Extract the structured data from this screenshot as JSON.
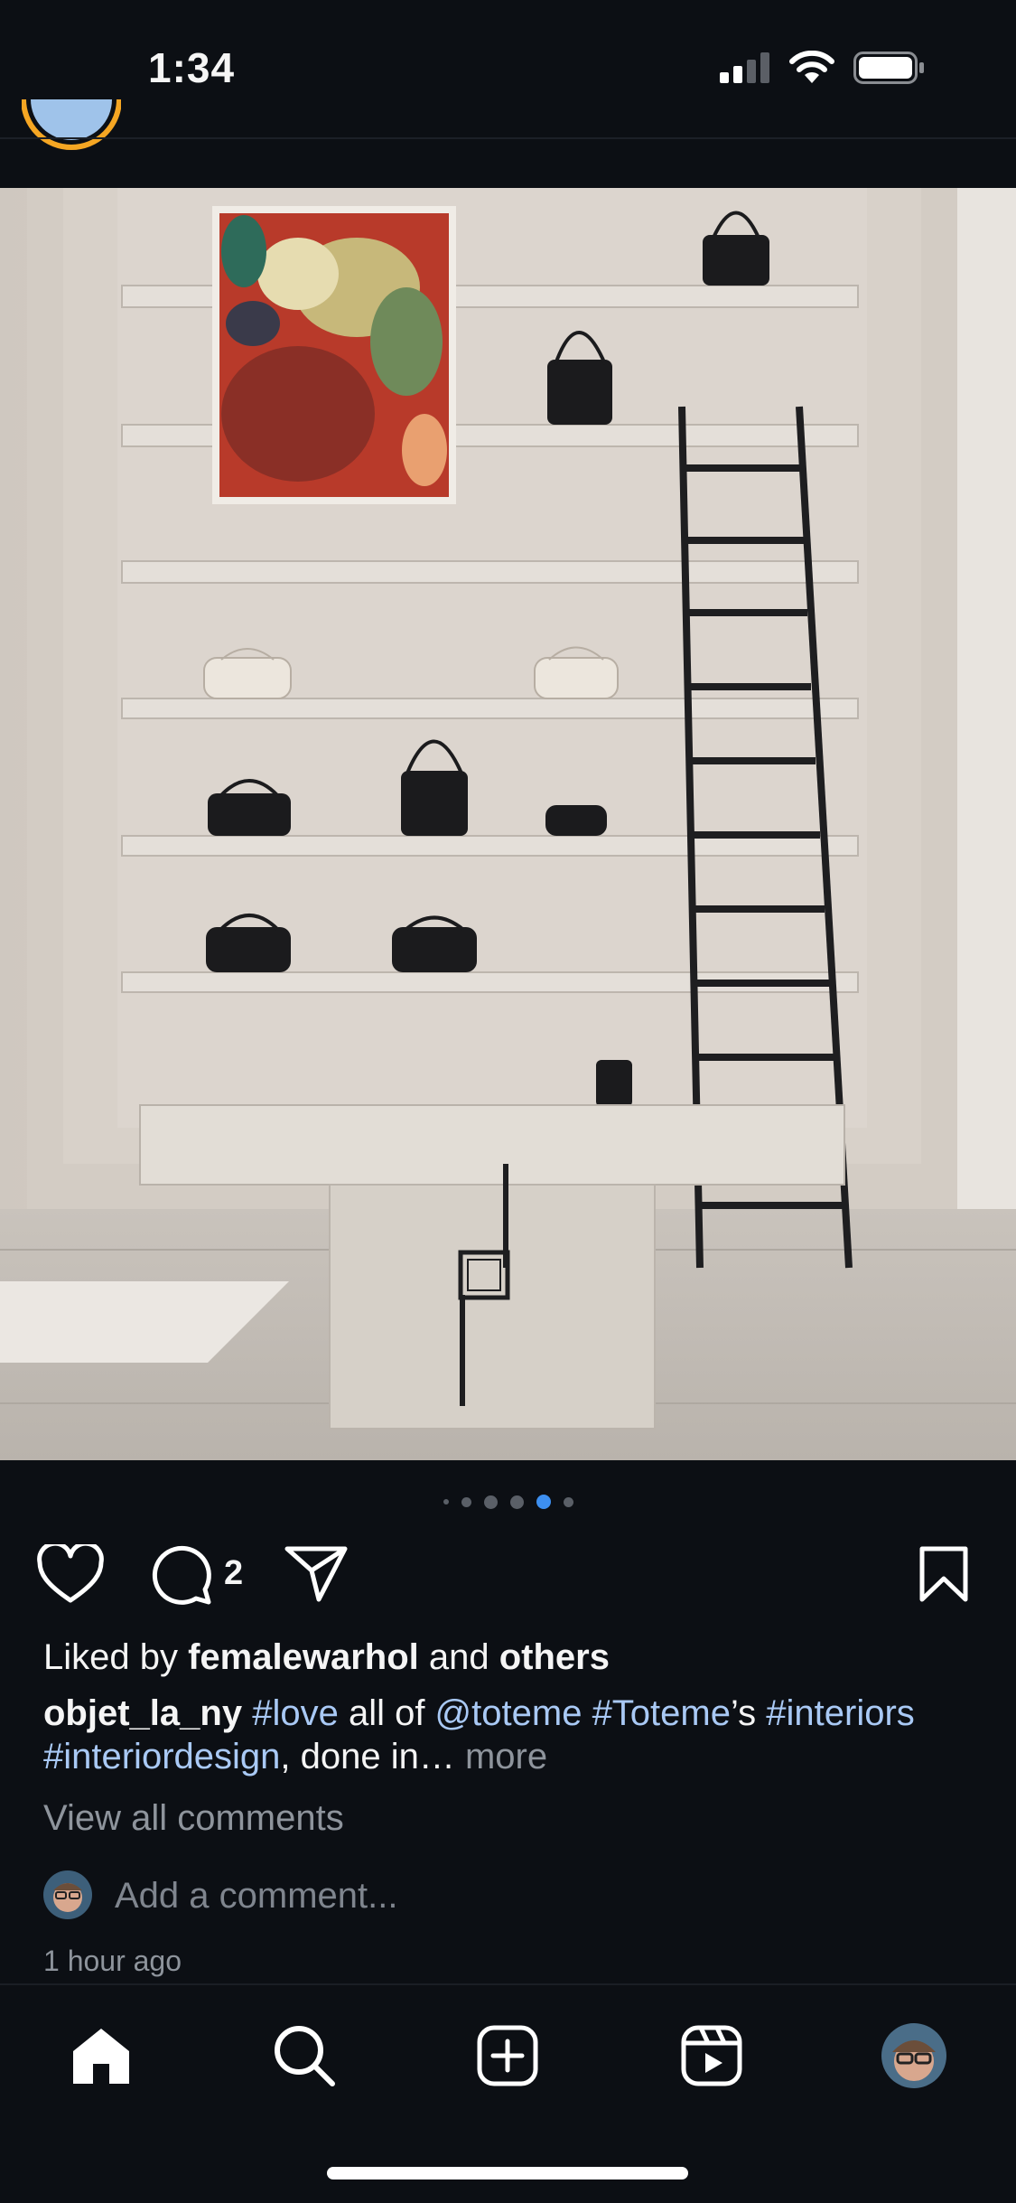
{
  "status_bar": {
    "time": "1:34"
  },
  "post": {
    "carousel": {
      "count": 6,
      "active_index": 4
    },
    "comment_count": "2",
    "liked_by_prefix": "Liked by ",
    "liked_by_user": "femalewarhol",
    "liked_by_and": " and ",
    "liked_by_others": "others",
    "caption": {
      "username": "objet_la_ny",
      "tag_love": "#love",
      "text_1": " all of ",
      "mention": "@toteme",
      "tag_toteme": "#Toteme",
      "text_2": "’s",
      "tag_interiors": "#interiors",
      "tag_interiordesign": "#interiordesign",
      "text_3": ", done in… ",
      "more": "more"
    },
    "view_all_comments": "View all comments",
    "add_comment_placeholder": "Add a comment...",
    "timestamp": "1 hour ago"
  },
  "tab_bar": {
    "items": [
      "home-icon",
      "search-icon",
      "create-icon",
      "reels-icon",
      "profile-avatar"
    ]
  },
  "colors": {
    "background": "#0c0f14",
    "accent": "#3d8ff0",
    "hashtag": "#a9c9f5",
    "muted": "#8e949c"
  }
}
